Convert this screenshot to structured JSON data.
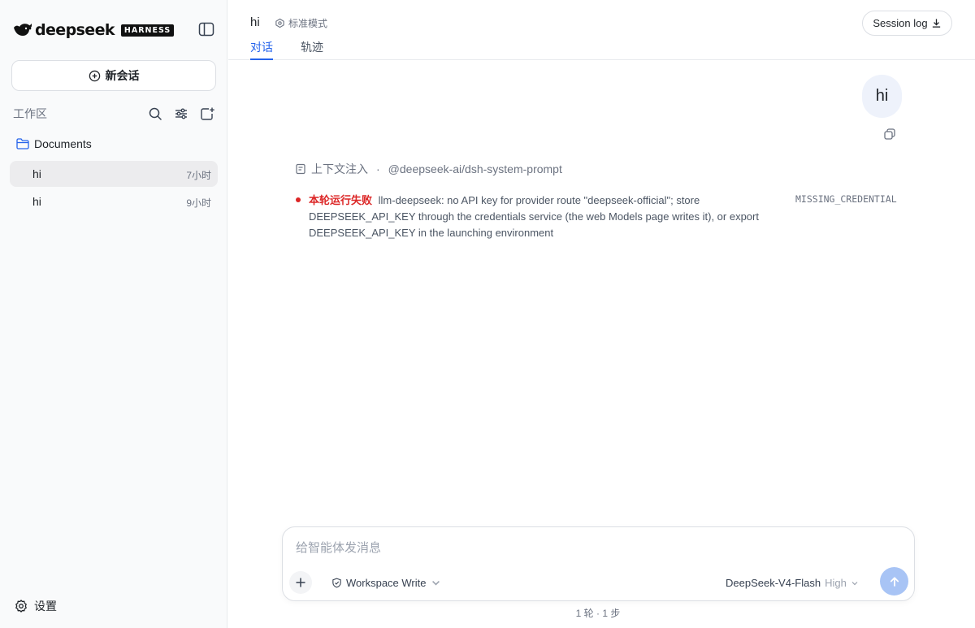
{
  "brand": {
    "wordmark": "deepseek",
    "badge": "HARNESS"
  },
  "sidebar": {
    "new_chat_label": "新会话",
    "workspace_label": "工作区",
    "folder": {
      "name": "Documents"
    },
    "conversations": [
      {
        "title": "hi",
        "time": "7小时",
        "active": true
      },
      {
        "title": "hi",
        "time": "9小时",
        "active": false
      }
    ],
    "settings_label": "设置"
  },
  "header": {
    "title": "hi",
    "mode_label": "标准模式",
    "tabs": [
      {
        "label": "对话",
        "active": true
      },
      {
        "label": "轨迹",
        "active": false
      }
    ],
    "session_log_label": "Session log"
  },
  "chat": {
    "user_message": "hi",
    "context": {
      "label": "上下文注入",
      "separator": "·",
      "source": "@deepseek-ai/dsh-system-prompt"
    },
    "error": {
      "label": "本轮运行失败",
      "message": "llm-deepseek: no API key for provider route \"deepseek-official\"; store DEEPSEEK_API_KEY through the credentials service (the web Models page writes it), or export DEEPSEEK_API_KEY in the launching environment",
      "code": "MISSING_CREDENTIAL"
    }
  },
  "composer": {
    "placeholder": "给智能体发消息",
    "value": "",
    "permission_label": "Workspace Write",
    "model_label": "DeepSeek-V4-Flash",
    "reasoning_level": "High"
  },
  "status": {
    "text": "1 轮 · 1 步"
  },
  "colors": {
    "accent": "#2563eb",
    "error": "#dc2626",
    "send_button": "#a8c4f5",
    "user_bubble": "#eef2fb"
  },
  "icons": [
    "whale-logo-icon",
    "sidebar-toggle-icon",
    "plus-circle-icon",
    "search-icon",
    "sliders-icon",
    "new-folder-icon",
    "folder-icon",
    "settings-gear-icon",
    "mode-icon",
    "download-icon",
    "copy-icon",
    "document-icon",
    "plus-icon",
    "shield-icon",
    "chevron-down-icon",
    "arrow-up-icon"
  ]
}
